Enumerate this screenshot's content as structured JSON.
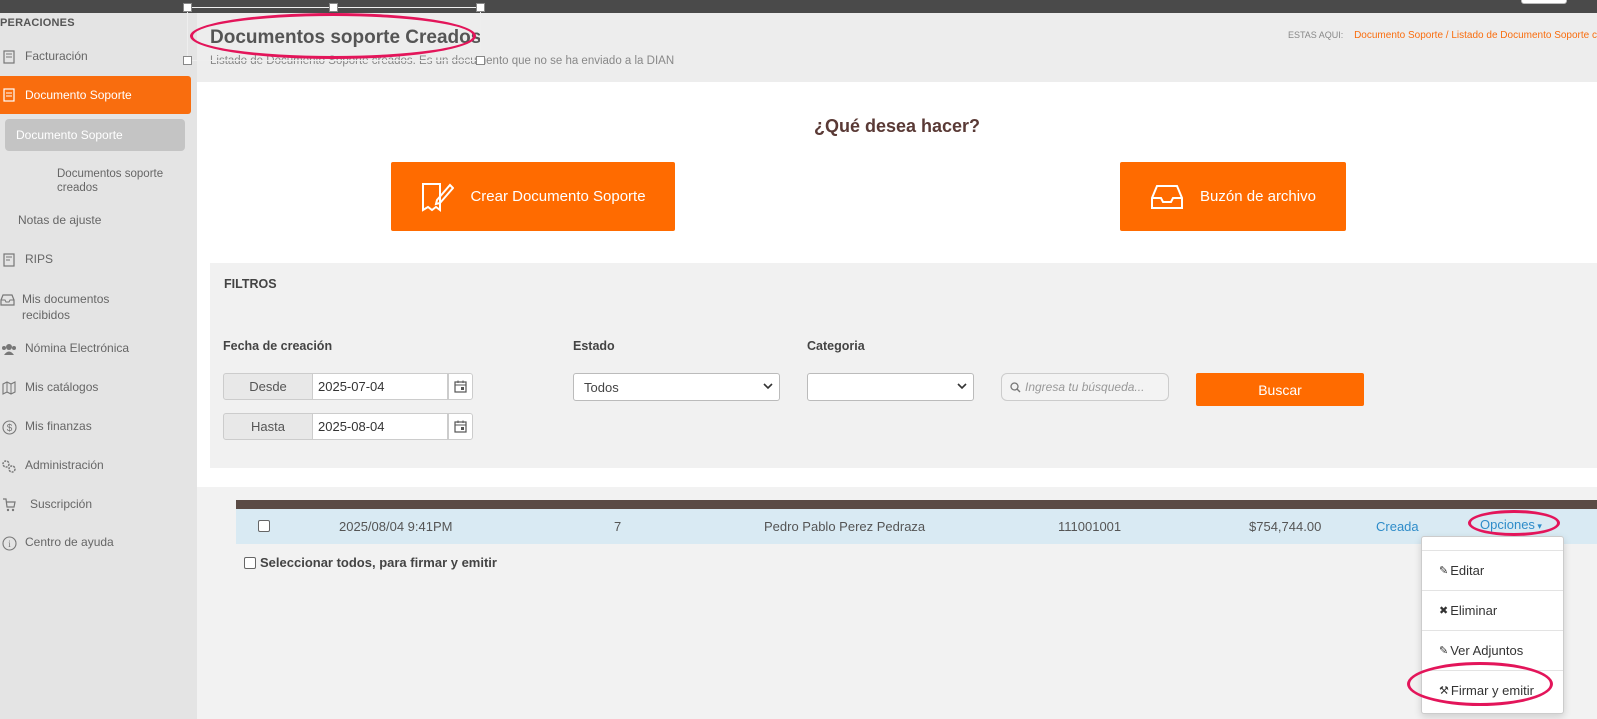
{
  "sidebar": {
    "section": "PERACIONES",
    "items": [
      {
        "label": "Facturación",
        "icon": "invoice-icon"
      },
      {
        "label": "Documento Soporte",
        "icon": "document-icon"
      },
      {
        "label": "RIPS",
        "icon": "receipt-icon"
      },
      {
        "label": "Mis documentos recibidos",
        "icon": "inbox-icon"
      },
      {
        "label": "Nómina Electrónica",
        "icon": "users-icon"
      },
      {
        "label": "Mis catálogos",
        "icon": "map-icon"
      },
      {
        "label": "Mis finanzas",
        "icon": "dollar-icon"
      },
      {
        "label": "Administración",
        "icon": "cogs-icon"
      },
      {
        "label": "Suscripción",
        "icon": "cart-icon"
      },
      {
        "label": "Centro de ayuda",
        "icon": "info-icon"
      }
    ],
    "sub_active": "Documento Soporte",
    "sub_child": "Documentos soporte creados",
    "sub_notas": "Notas de ajuste"
  },
  "header": {
    "title": "Documentos soporte Creados",
    "subtitle": "Listado de Documento Soporte creados. Es un documento que no se ha enviado a la DIAN",
    "breadcrumb_label": "ESTAS AQUI:",
    "breadcrumb_path": "Documento Soporte / Listado de Documento Soporte c"
  },
  "actions": {
    "question": "¿Qué desea hacer?",
    "create_label": "Crear Documento Soporte",
    "mailbox_label": "Buzón de archivo"
  },
  "filters": {
    "title": "FILTROS",
    "date_label": "Fecha de creación",
    "from_label": "Desde",
    "from_value": "2025-07-04",
    "to_label": "Hasta",
    "to_value": "2025-08-04",
    "estado_label": "Estado",
    "estado_value": "Todos",
    "categoria_label": "Categoria",
    "categoria_value": "",
    "search_placeholder": "Ingresa tu búsqueda...",
    "search_button": "Buscar"
  },
  "table": {
    "rows": [
      {
        "fecha": "2025/08/04 9:41PM",
        "numero": "7",
        "nombre": "Pedro Pablo Perez Pedraza",
        "nit": "111001001",
        "valor": "$754,744.00",
        "estado": "Creada",
        "opciones": "Opciones"
      }
    ],
    "select_all": "Seleccionar todos, para firmar y emitir"
  },
  "dropdown": {
    "items": [
      "Editar",
      "Eliminar",
      "Ver Adjuntos",
      "Firmar y emitir"
    ]
  },
  "colors": {
    "accent": "#ff6b00",
    "annotation": "#e3155a",
    "link": "#2e8cc9"
  }
}
